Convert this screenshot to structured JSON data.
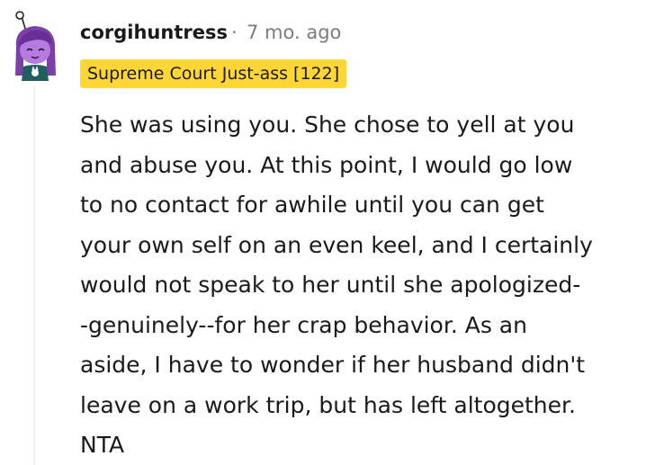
{
  "comment": {
    "author": "corgihuntress",
    "separator": "·",
    "timestamp": "7 mo. ago",
    "flair": "Supreme Court Just-ass [122]",
    "body_lines": [
      "She was using you. She chose to yell at you",
      "and abuse you. At this point, I would go low",
      "to no contact for awhile until you can get",
      "your own self on an even keel, and I certainly",
      "would not speak to her until she apologized-",
      "-genuinely--for her crap behavior. As an",
      "aside, I have to wonder if her husband didn't",
      "leave on a work trip, but has left altogether.",
      "NTA"
    ]
  },
  "colors": {
    "flair_bg": "#ffd635",
    "avatar_hair": "#7b3fa8",
    "avatar_face": "#b57be0",
    "avatar_shirt": "#1f5f5f",
    "meta_text": "#7c7c7c"
  }
}
